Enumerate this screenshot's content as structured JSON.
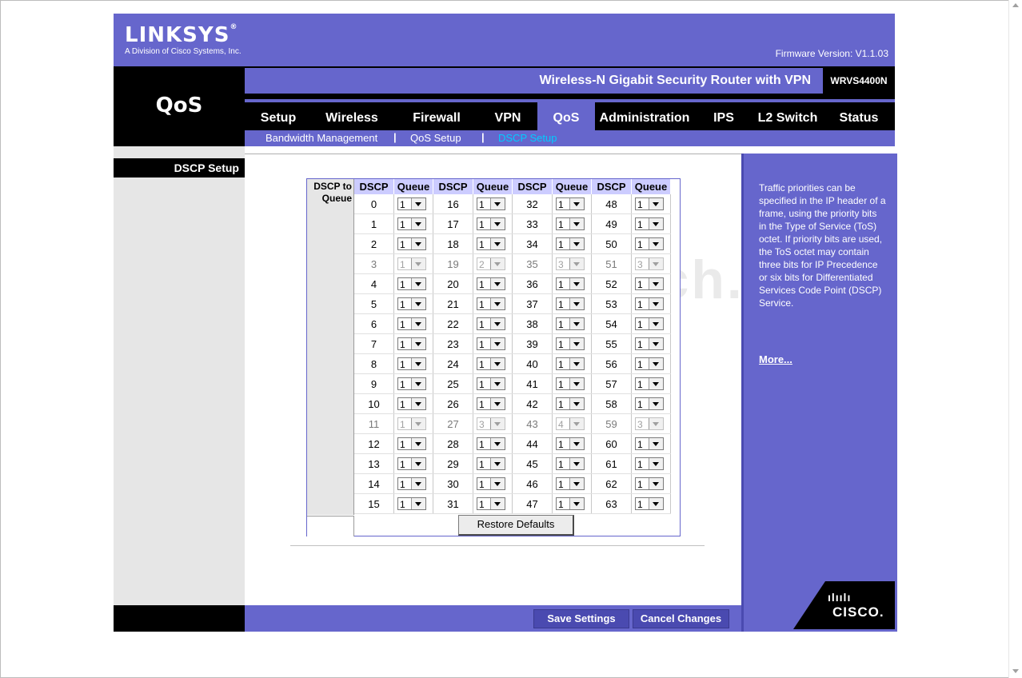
{
  "brand": {
    "logo": "LINKSYS",
    "registered": "®",
    "subtitle": "A Division of Cisco Systems, Inc.",
    "firmware": "Firmware Version: V1.1.03"
  },
  "product": {
    "name": "Wireless-N Gigabit Security Router with VPN",
    "model": "WRVS4400N"
  },
  "section_title": "QoS",
  "tabs": [
    {
      "label": "Setup"
    },
    {
      "label": "Wireless"
    },
    {
      "label": "Firewall"
    },
    {
      "label": "VPN"
    },
    {
      "label": "QoS",
      "active": true
    },
    {
      "label": "Administration"
    },
    {
      "label": "IPS"
    },
    {
      "label": "L2 Switch"
    },
    {
      "label": "Status"
    }
  ],
  "subtabs": [
    {
      "label": "Bandwidth Management"
    },
    {
      "label": "QoS Setup"
    },
    {
      "label": "DSCP Setup",
      "active": true
    }
  ],
  "separator": "|",
  "side_label": "DSCP Setup",
  "grid": {
    "label_line1": "DSCP to",
    "label_line2": "Queue",
    "headers": [
      "DSCP",
      "Queue",
      "DSCP",
      "Queue",
      "DSCP",
      "Queue",
      "DSCP",
      "Queue"
    ],
    "rows": [
      [
        [
          0,
          "1"
        ],
        [
          16,
          "1"
        ],
        [
          32,
          "1"
        ],
        [
          48,
          "1"
        ]
      ],
      [
        [
          1,
          "1"
        ],
        [
          17,
          "1"
        ],
        [
          33,
          "1"
        ],
        [
          49,
          "1"
        ]
      ],
      [
        [
          2,
          "1"
        ],
        [
          18,
          "1"
        ],
        [
          34,
          "1"
        ],
        [
          50,
          "1"
        ]
      ],
      [
        [
          3,
          "1"
        ],
        [
          19,
          "2"
        ],
        [
          35,
          "3"
        ],
        [
          51,
          "3"
        ]
      ],
      [
        [
          4,
          "1"
        ],
        [
          20,
          "1"
        ],
        [
          36,
          "1"
        ],
        [
          52,
          "1"
        ]
      ],
      [
        [
          5,
          "1"
        ],
        [
          21,
          "1"
        ],
        [
          37,
          "1"
        ],
        [
          53,
          "1"
        ]
      ],
      [
        [
          6,
          "1"
        ],
        [
          22,
          "1"
        ],
        [
          38,
          "1"
        ],
        [
          54,
          "1"
        ]
      ],
      [
        [
          7,
          "1"
        ],
        [
          23,
          "1"
        ],
        [
          39,
          "1"
        ],
        [
          55,
          "1"
        ]
      ],
      [
        [
          8,
          "1"
        ],
        [
          24,
          "1"
        ],
        [
          40,
          "1"
        ],
        [
          56,
          "1"
        ]
      ],
      [
        [
          9,
          "1"
        ],
        [
          25,
          "1"
        ],
        [
          41,
          "1"
        ],
        [
          57,
          "1"
        ]
      ],
      [
        [
          10,
          "1"
        ],
        [
          26,
          "1"
        ],
        [
          42,
          "1"
        ],
        [
          58,
          "1"
        ]
      ],
      [
        [
          11,
          "1"
        ],
        [
          27,
          "3"
        ],
        [
          43,
          "4"
        ],
        [
          59,
          "3"
        ]
      ],
      [
        [
          12,
          "1"
        ],
        [
          28,
          "1"
        ],
        [
          44,
          "1"
        ],
        [
          60,
          "1"
        ]
      ],
      [
        [
          13,
          "1"
        ],
        [
          29,
          "1"
        ],
        [
          45,
          "1"
        ],
        [
          61,
          "1"
        ]
      ],
      [
        [
          14,
          "1"
        ],
        [
          30,
          "1"
        ],
        [
          46,
          "1"
        ],
        [
          62,
          "1"
        ]
      ],
      [
        [
          15,
          "1"
        ],
        [
          31,
          "1"
        ],
        [
          47,
          "1"
        ],
        [
          63,
          "1"
        ]
      ]
    ],
    "disabled_rows": [
      3,
      11
    ],
    "restore_button": "Restore Defaults"
  },
  "help": {
    "text": "Traffic priorities can be specified in the IP header of a frame, using the priority bits in the Type of Service (ToS) octet. If priority bits are used, the ToS octet may contain three bits for IP Precedence or six bits for Differentiated Services Code Point (DSCP) Service.",
    "more": "More..."
  },
  "footer": {
    "save": "Save Settings",
    "cancel": "Cancel Changes"
  },
  "cisco": {
    "bars": "ılıılı",
    "text": "CISCO."
  },
  "watermark": "PcWinTech.com",
  "colors": {
    "purple": "#6666cc",
    "header_cell": "#ccccff",
    "active_subtab": "#00ccff"
  }
}
